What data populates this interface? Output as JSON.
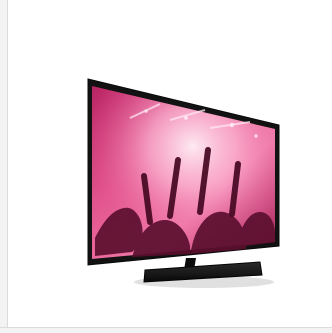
{
  "image": {
    "subject": "tv-product-photo",
    "colors": {
      "background": "#ffffff",
      "bezel": "#141414",
      "screen_pink": "#e64b8f",
      "screen_light": "#ffd3e8",
      "stand": "#111111"
    }
  }
}
